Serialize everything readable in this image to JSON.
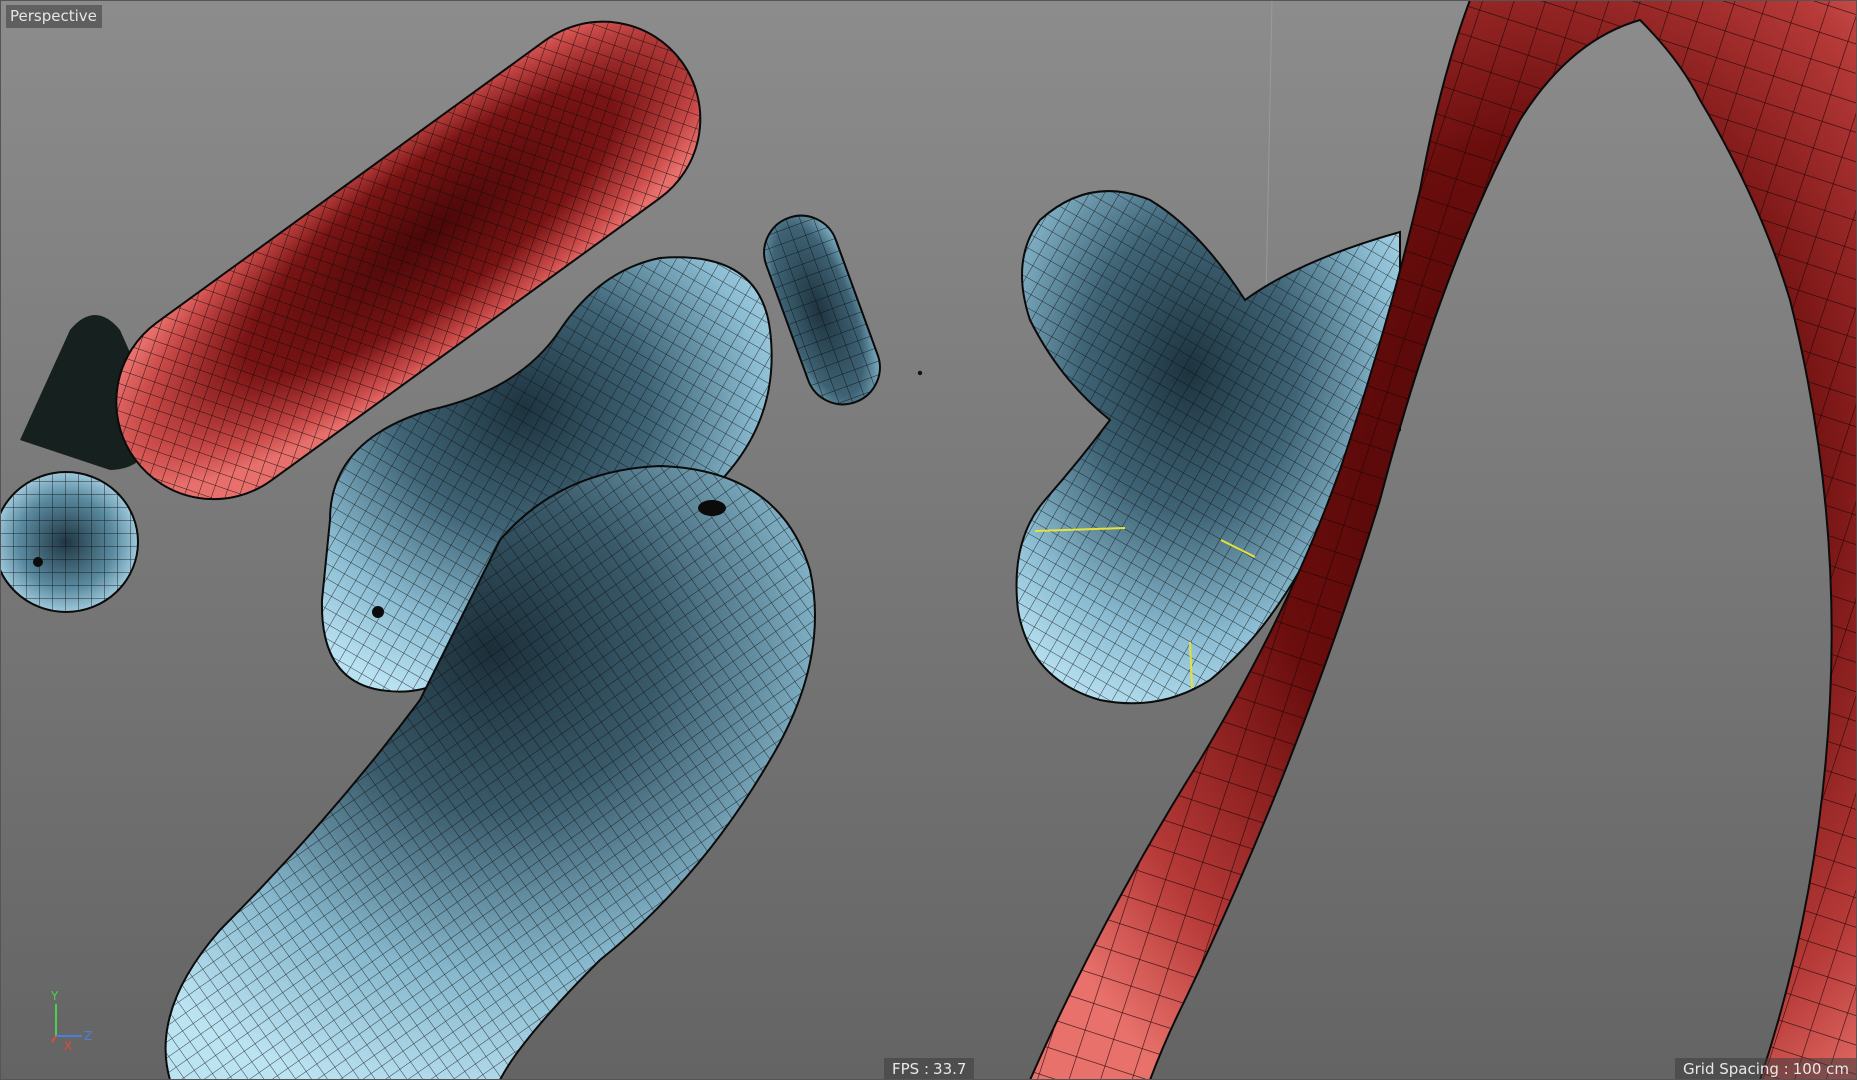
{
  "viewport": {
    "view_name": "Perspective",
    "fps_label": "FPS :",
    "fps_value": "33.7",
    "grid_spacing_label": "Grid Spacing :",
    "grid_spacing_value": "100 cm",
    "axis": {
      "y": "Y",
      "x": "X",
      "z": "Z"
    }
  },
  "colors": {
    "background": "#7a7a7a",
    "red_object": "#e0605d",
    "red_object_dark": "#5a0a0a",
    "blue_object": "#a9d3e6",
    "blue_object_dark": "#243a47",
    "wire": "#0b0b0b",
    "selection_edges": "#e6e23a",
    "axis_y": "#4fcf4f",
    "axis_x": "#e04a3a",
    "axis_z": "#4a7fe0"
  },
  "objects": [
    {
      "name": "Red capsule",
      "material": "red"
    },
    {
      "name": "Dark capsule",
      "material": "blue"
    },
    {
      "name": "Small blue sphere",
      "material": "blue"
    },
    {
      "name": "Blue bent tube",
      "material": "blue"
    },
    {
      "name": "Blue bent tube front",
      "material": "blue"
    },
    {
      "name": "Small dark pill",
      "material": "blue"
    },
    {
      "name": "Blue bent tube right",
      "material": "blue"
    },
    {
      "name": "Large red curved tube",
      "material": "red"
    }
  ]
}
